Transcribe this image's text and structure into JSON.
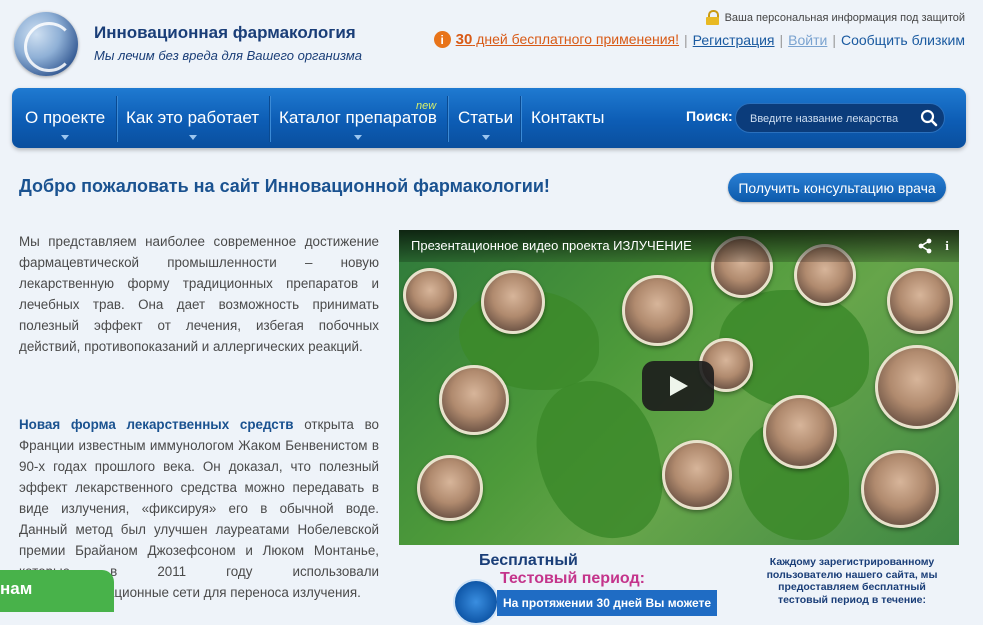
{
  "brand": {
    "title": "Инновационная фармакология",
    "subtitle": "Мы лечим без вреда для Вашего организма"
  },
  "header": {
    "secure_text": "Ваша персональная информация под защитой",
    "promo_number": "30",
    "promo_text": " дней бесплатного применения!",
    "register_label": "Регистрация",
    "login_label": "Войти",
    "tell_friends_label": "Сообщить близким"
  },
  "nav": {
    "items": [
      {
        "label": "О проекте"
      },
      {
        "label": "Как это работает"
      },
      {
        "label": "Каталог препаратов",
        "badge": "new"
      },
      {
        "label": "Статьи"
      },
      {
        "label": "Контакты"
      }
    ],
    "search_label": "Поиск:",
    "search_placeholder": "Введите название лекарства"
  },
  "main": {
    "welcome": "Добро пожаловать на сайт Инновационной фармакологии!",
    "consult_button": "Получить консультацию врача",
    "para1": "Мы представляем наиболее современное достижение фармацевтической промышленности – новую лекарственную форму традиционных препаратов и лечебных трав. Она дает возможность принимать полезный эффект от лечения, избегая побочных действий, противопоказаний и аллергических реакций.",
    "para2_bold": "Новая форма лекарственных средств",
    "para2_rest": " открыта во Франции известным иммунологом Жаком Бенвенистом в 90-х годах прошлого века. Он доказал, что полезный эффект лекарственного средства можно передавать в виде излучения, «фиксируя» его в обычной воде. Данный метод был улучшен лауреатами Нобелевской премии Брайаном Джозефсоном и Люком Монтанье, которые в 2011 году использовали телекоммуникационные сети для переноса излучения."
  },
  "video": {
    "title": "Презентационное видео проекта ИЗЛУЧЕНИЕ"
  },
  "promo_block": {
    "free": "Бесплатный",
    "test_period": "Тестовый период:",
    "bar_text": "На протяжении 30 дней Вы можете",
    "side_note": "Каждому зарегистрированному пользователю нашего сайта, мы предоставляем бесплатный тестовый период в течение:"
  },
  "floating_tab": {
    "label": "нам"
  },
  "colors": {
    "nav_blue": "#0d5db5",
    "brand_dark": "#1a3e78",
    "promo_orange": "#d85a16",
    "accent_pink": "#c4348b",
    "tab_green": "#48b24a"
  }
}
